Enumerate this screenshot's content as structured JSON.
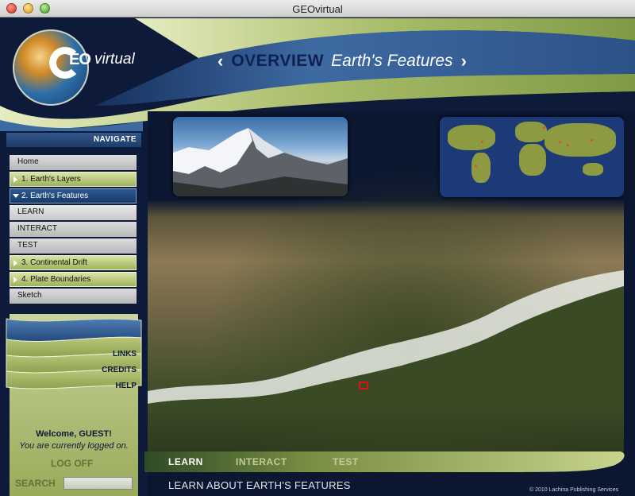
{
  "window": {
    "title": "GEOvirtual"
  },
  "logo": {
    "eo": "EO",
    "virtual": "virtual"
  },
  "header": {
    "left_chevron": "‹",
    "section": "OVERVIEW",
    "subtitle": "Earth's Features",
    "right_chevron": "›"
  },
  "nav": {
    "title": "NAVIGATE",
    "items": [
      {
        "label": "Home"
      },
      {
        "label": "1. Earth's Layers"
      },
      {
        "label": "2. Earth's Features"
      },
      {
        "label": "LEARN"
      },
      {
        "label": "INTERACT"
      },
      {
        "label": "TEST"
      },
      {
        "label": "3. Continental Drift"
      },
      {
        "label": "4. Plate Boundaries"
      },
      {
        "label": "Sketch"
      }
    ],
    "links": "LINKS",
    "credits": "CREDITS",
    "help": "HELP"
  },
  "user": {
    "welcome": "Welcome, GUEST!",
    "status": "You are currently logged on.",
    "logoff": "LOG OFF",
    "search_label": "SEARCH",
    "search_value": ""
  },
  "tabs": {
    "learn": "LEARN",
    "interact": "INTERACT",
    "test": "TEST"
  },
  "footer": {
    "caption": "LEARN ABOUT EARTH'S FEATURES",
    "copyright": "© 2010 Lachina Publishing Services"
  },
  "colors": {
    "accent_green": "#9bb35c",
    "navy": "#0d1a3a",
    "active_blue": "#2d5b8e"
  }
}
